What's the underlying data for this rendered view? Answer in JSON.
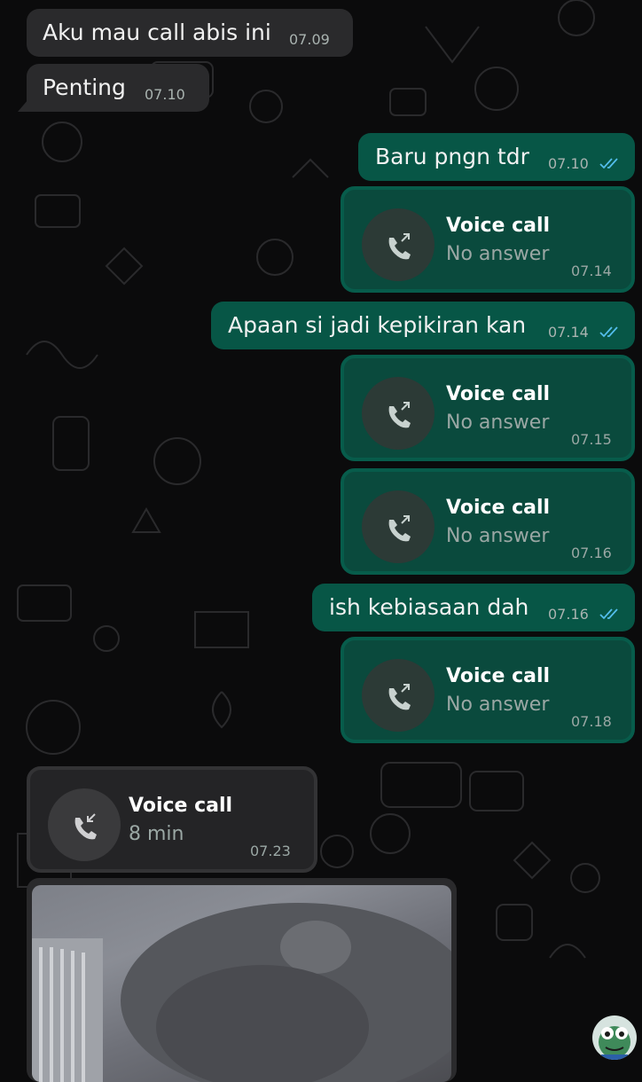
{
  "messages": [
    {
      "text": "Aku mau call abis ini",
      "time": "07.09"
    },
    {
      "text": "Penting",
      "time": "07.10"
    },
    {
      "text": "Baru pngn tdr",
      "time": "07.10"
    },
    {
      "call_title": "Voice call",
      "call_status": "No answer",
      "time": "07.14"
    },
    {
      "text": "Apaan si jadi kepikiran kan",
      "time": "07.14"
    },
    {
      "call_title": "Voice call",
      "call_status": "No answer",
      "time": "07.15"
    },
    {
      "call_title": "Voice call",
      "call_status": "No answer",
      "time": "07.16"
    },
    {
      "text": "ish kebiasaan dah",
      "time": "07.16"
    },
    {
      "call_title": "Voice call",
      "call_status": "No answer",
      "time": "07.18"
    },
    {
      "call_title": "Voice call",
      "call_status": "8 min",
      "time": "07.23"
    }
  ],
  "colors": {
    "background": "#0b0b0c",
    "incoming_bubble": "#2a2a2c",
    "outgoing_bubble": "#075646",
    "read_ticks": "#53bdeb"
  },
  "icons": {
    "outgoing_call": "phone-outgoing-arrow-icon",
    "incoming_call": "phone-incoming-arrow-icon",
    "read_receipt": "double-check-icon"
  }
}
